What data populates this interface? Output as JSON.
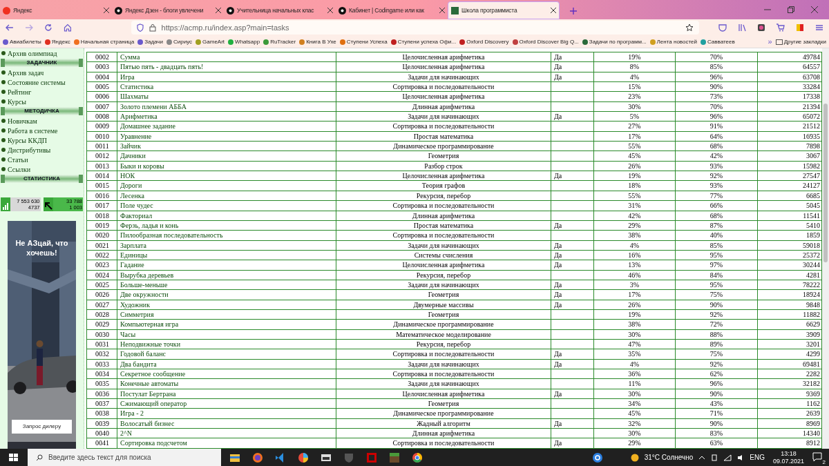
{
  "browser": {
    "tabs": [
      {
        "title": "Яндекс",
        "selected": false
      },
      {
        "title": "Яндекс Дзен - блоги увлечени",
        "selected": false
      },
      {
        "title": "Учительница начальных клас",
        "selected": false
      },
      {
        "title": "Кабинет | Codingame или как",
        "selected": false
      },
      {
        "title": "Школа программиста",
        "selected": true
      }
    ],
    "url": "https://acmp.ru/index.asp?main=tasks",
    "bookmarks": [
      "Авиабилеты",
      "Яндекс",
      "Начальная страница",
      "Задачи",
      "Сириус",
      "GameArt",
      "Whatsapp",
      "RuTracker",
      "Книга В Ухе",
      "Ступени Успеха",
      "Ступени успеха Офи...",
      "Oxford Discovery",
      "Oxford Discover Big Q...",
      "Задачи по программ...",
      "Лента новостей",
      "Савватеев"
    ],
    "more_bookmarks": "»",
    "other_bookmarks": "Другие закладки"
  },
  "sidebar": [
    {
      "kind": "link",
      "text": "Архив олимпиад"
    },
    {
      "kind": "header",
      "text": "ЗАДАЧНИК"
    },
    {
      "kind": "link",
      "text": "Архив задач"
    },
    {
      "kind": "link",
      "text": "Состояние системы"
    },
    {
      "kind": "link",
      "text": "Рейтинг"
    },
    {
      "kind": "link",
      "text": "Курсы"
    },
    {
      "kind": "header",
      "text": "МЕТОДИЧКА"
    },
    {
      "kind": "link",
      "text": "Новичкам"
    },
    {
      "kind": "link",
      "text": "Работа в системе"
    },
    {
      "kind": "link",
      "text": "Курсы ККДП"
    },
    {
      "kind": "link",
      "text": "Дистрибутивы"
    },
    {
      "kind": "link",
      "text": "Статьи"
    },
    {
      "kind": "link",
      "text": "Ссылки"
    },
    {
      "kind": "header",
      "text": "СТАТИСТИКА"
    }
  ],
  "counters": [
    [
      "7 553 630",
      "4737"
    ],
    [
      "33 788",
      "1 003"
    ]
  ],
  "ad": {
    "headline": "Не АЗцай, что хочешь!",
    "button": "Запрос дилеру"
  },
  "tasks": [
    {
      "num": "0002",
      "name": "Сумма",
      "category": "Целочисленная арифметика",
      "flag": "Да",
      "difficulty": "19%",
      "solvability": "70%",
      "solved": "49784"
    },
    {
      "num": "0003",
      "name": "Пятью пять - двадцать пять!",
      "category": "Целочисленная арифметика",
      "flag": "Да",
      "difficulty": "8%",
      "solvability": "85%",
      "solved": "64557"
    },
    {
      "num": "0004",
      "name": "Игра",
      "category": "Задачи для начинающих",
      "flag": "Да",
      "difficulty": "4%",
      "solvability": "96%",
      "solved": "63708"
    },
    {
      "num": "0005",
      "name": "Статистика",
      "category": "Сортировка и последовательности",
      "difficulty": "15%",
      "solvability": "90%",
      "solved": "33284"
    },
    {
      "num": "0006",
      "name": "Шахматы",
      "category": "Целочисленная арифметика",
      "difficulty": "23%",
      "solvability": "73%",
      "solved": "17338"
    },
    {
      "num": "0007",
      "name": "Золото племени АББА",
      "category": "Длинная арифметика",
      "difficulty": "30%",
      "solvability": "70%",
      "solved": "21394"
    },
    {
      "num": "0008",
      "name": "Арифметика",
      "category": "Задачи для начинающих",
      "flag": "Да",
      "difficulty": "5%",
      "solvability": "96%",
      "solved": "65072"
    },
    {
      "num": "0009",
      "name": "Домашнее задание",
      "category": "Сортировка и последовательности",
      "difficulty": "27%",
      "solvability": "91%",
      "solved": "21512"
    },
    {
      "num": "0010",
      "name": "Уравнение",
      "category": "Простая математика",
      "difficulty": "17%",
      "solvability": "64%",
      "solved": "16935"
    },
    {
      "num": "0011",
      "name": "Зайчик",
      "category": "Динамическое программирование",
      "difficulty": "55%",
      "solvability": "68%",
      "solved": "7898"
    },
    {
      "num": "0012",
      "name": "Дачники",
      "category": "Геометрия",
      "difficulty": "45%",
      "solvability": "42%",
      "solved": "3067"
    },
    {
      "num": "0013",
      "name": "Быки и коровы",
      "category": "Разбор строк",
      "difficulty": "26%",
      "solvability": "93%",
      "solved": "15982"
    },
    {
      "num": "0014",
      "name": "НОК",
      "category": "Целочисленная арифметика",
      "flag": "Да",
      "difficulty": "19%",
      "solvability": "92%",
      "solved": "27547"
    },
    {
      "num": "0015",
      "name": "Дороги",
      "category": "Теория графов",
      "difficulty": "18%",
      "solvability": "93%",
      "solved": "24127"
    },
    {
      "num": "0016",
      "name": "Лесенка",
      "category": "Рекурсия, перебор",
      "difficulty": "55%",
      "solvability": "77%",
      "solved": "6685"
    },
    {
      "num": "0017",
      "name": "Поле чудес",
      "category": "Сортировка и последовательности",
      "difficulty": "31%",
      "solvability": "66%",
      "solved": "5045"
    },
    {
      "num": "0018",
      "name": "Факториал",
      "category": "Длинная арифметика",
      "difficulty": "42%",
      "solvability": "68%",
      "solved": "11541"
    },
    {
      "num": "0019",
      "name": "Ферзь, ладья и конь",
      "category": "Простая математика",
      "flag": "Да",
      "difficulty": "29%",
      "solvability": "87%",
      "solved": "5410"
    },
    {
      "num": "0020",
      "name": "Пилообразная последовательность",
      "category": "Сортировка и последовательности",
      "difficulty": "38%",
      "solvability": "40%",
      "solved": "1859"
    },
    {
      "num": "0021",
      "name": "Зарплата",
      "category": "Задачи для начинающих",
      "flag": "Да",
      "difficulty": "4%",
      "solvability": "85%",
      "solved": "59018"
    },
    {
      "num": "0022",
      "name": "Единицы",
      "category": "Системы счисления",
      "flag": "Да",
      "difficulty": "16%",
      "solvability": "95%",
      "solved": "25372"
    },
    {
      "num": "0023",
      "name": "Гадание",
      "category": "Целочисленная арифметика",
      "flag": "Да",
      "difficulty": "13%",
      "solvability": "97%",
      "solved": "30244"
    },
    {
      "num": "0024",
      "name": "Вырубка деревьев",
      "category": "Рекурсия, перебор",
      "difficulty": "46%",
      "solvability": "84%",
      "solved": "4281"
    },
    {
      "num": "0025",
      "name": "Больше-меньше",
      "category": "Задачи для начинающих",
      "flag": "Да",
      "difficulty": "3%",
      "solvability": "95%",
      "solved": "78222"
    },
    {
      "num": "0026",
      "name": "Две окружности",
      "category": "Геометрия",
      "flag": "Да",
      "difficulty": "17%",
      "solvability": "75%",
      "solved": "18924"
    },
    {
      "num": "0027",
      "name": "Художник",
      "category": "Двумерные массивы",
      "flag": "Да",
      "difficulty": "26%",
      "solvability": "90%",
      "solved": "9848"
    },
    {
      "num": "0028",
      "name": "Симметрия",
      "category": "Геометрия",
      "difficulty": "19%",
      "solvability": "92%",
      "solved": "11882"
    },
    {
      "num": "0029",
      "name": "Компьютерная игра",
      "category": "Динамическое программирование",
      "difficulty": "38%",
      "solvability": "72%",
      "solved": "6629"
    },
    {
      "num": "0030",
      "name": "Часы",
      "category": "Математическое моделирование",
      "difficulty": "30%",
      "solvability": "88%",
      "solved": "3909"
    },
    {
      "num": "0031",
      "name": "Неподвижные точки",
      "category": "Рекурсия, перебор",
      "difficulty": "47%",
      "solvability": "89%",
      "solved": "3201"
    },
    {
      "num": "0032",
      "name": "Годовой баланс",
      "category": "Сортировка и последовательности",
      "flag": "Да",
      "difficulty": "35%",
      "solvability": "75%",
      "solved": "4299"
    },
    {
      "num": "0033",
      "name": "Два бандита",
      "category": "Задачи для начинающих",
      "flag": "Да",
      "difficulty": "4%",
      "solvability": "92%",
      "solved": "69481"
    },
    {
      "num": "0034",
      "name": "Секретное сообщение",
      "category": "Сортировка и последовательности",
      "difficulty": "36%",
      "solvability": "62%",
      "solved": "2282"
    },
    {
      "num": "0035",
      "name": "Конечные автоматы",
      "category": "Задачи для начинающих",
      "difficulty": "11%",
      "solvability": "96%",
      "solved": "32182"
    },
    {
      "num": "0036",
      "name": "Постулат Бертрана",
      "category": "Целочисленная арифметика",
      "flag": "Да",
      "difficulty": "30%",
      "solvability": "90%",
      "solved": "9369"
    },
    {
      "num": "0037",
      "name": "Сжимающий оператор",
      "category": "Геометрия",
      "difficulty": "34%",
      "solvability": "43%",
      "solved": "1162"
    },
    {
      "num": "0038",
      "name": "Игра - 2",
      "category": "Динамическое программирование",
      "difficulty": "45%",
      "solvability": "71%",
      "solved": "2639"
    },
    {
      "num": "0039",
      "name": "Волосатый бизнес",
      "category": "Жадный алгоритм",
      "flag": "Да",
      "difficulty": "32%",
      "solvability": "90%",
      "solved": "8969"
    },
    {
      "num": "0040",
      "name": "2^N",
      "category": "Длинная арифметика",
      "difficulty": "30%",
      "solvability": "83%",
      "solved": "14340"
    },
    {
      "num": "0041",
      "name": "Сортировка подсчетом",
      "category": "Сортировка и последовательности",
      "flag": "Да",
      "difficulty": "29%",
      "solvability": "63%",
      "solved": "8912"
    }
  ],
  "taskbar": {
    "search_placeholder": "Введите здесь текст для поиска",
    "weather": "31°C Солнечно",
    "language": "ENG",
    "time": "13:18",
    "date": "09.07.2021",
    "notifications": "2"
  }
}
